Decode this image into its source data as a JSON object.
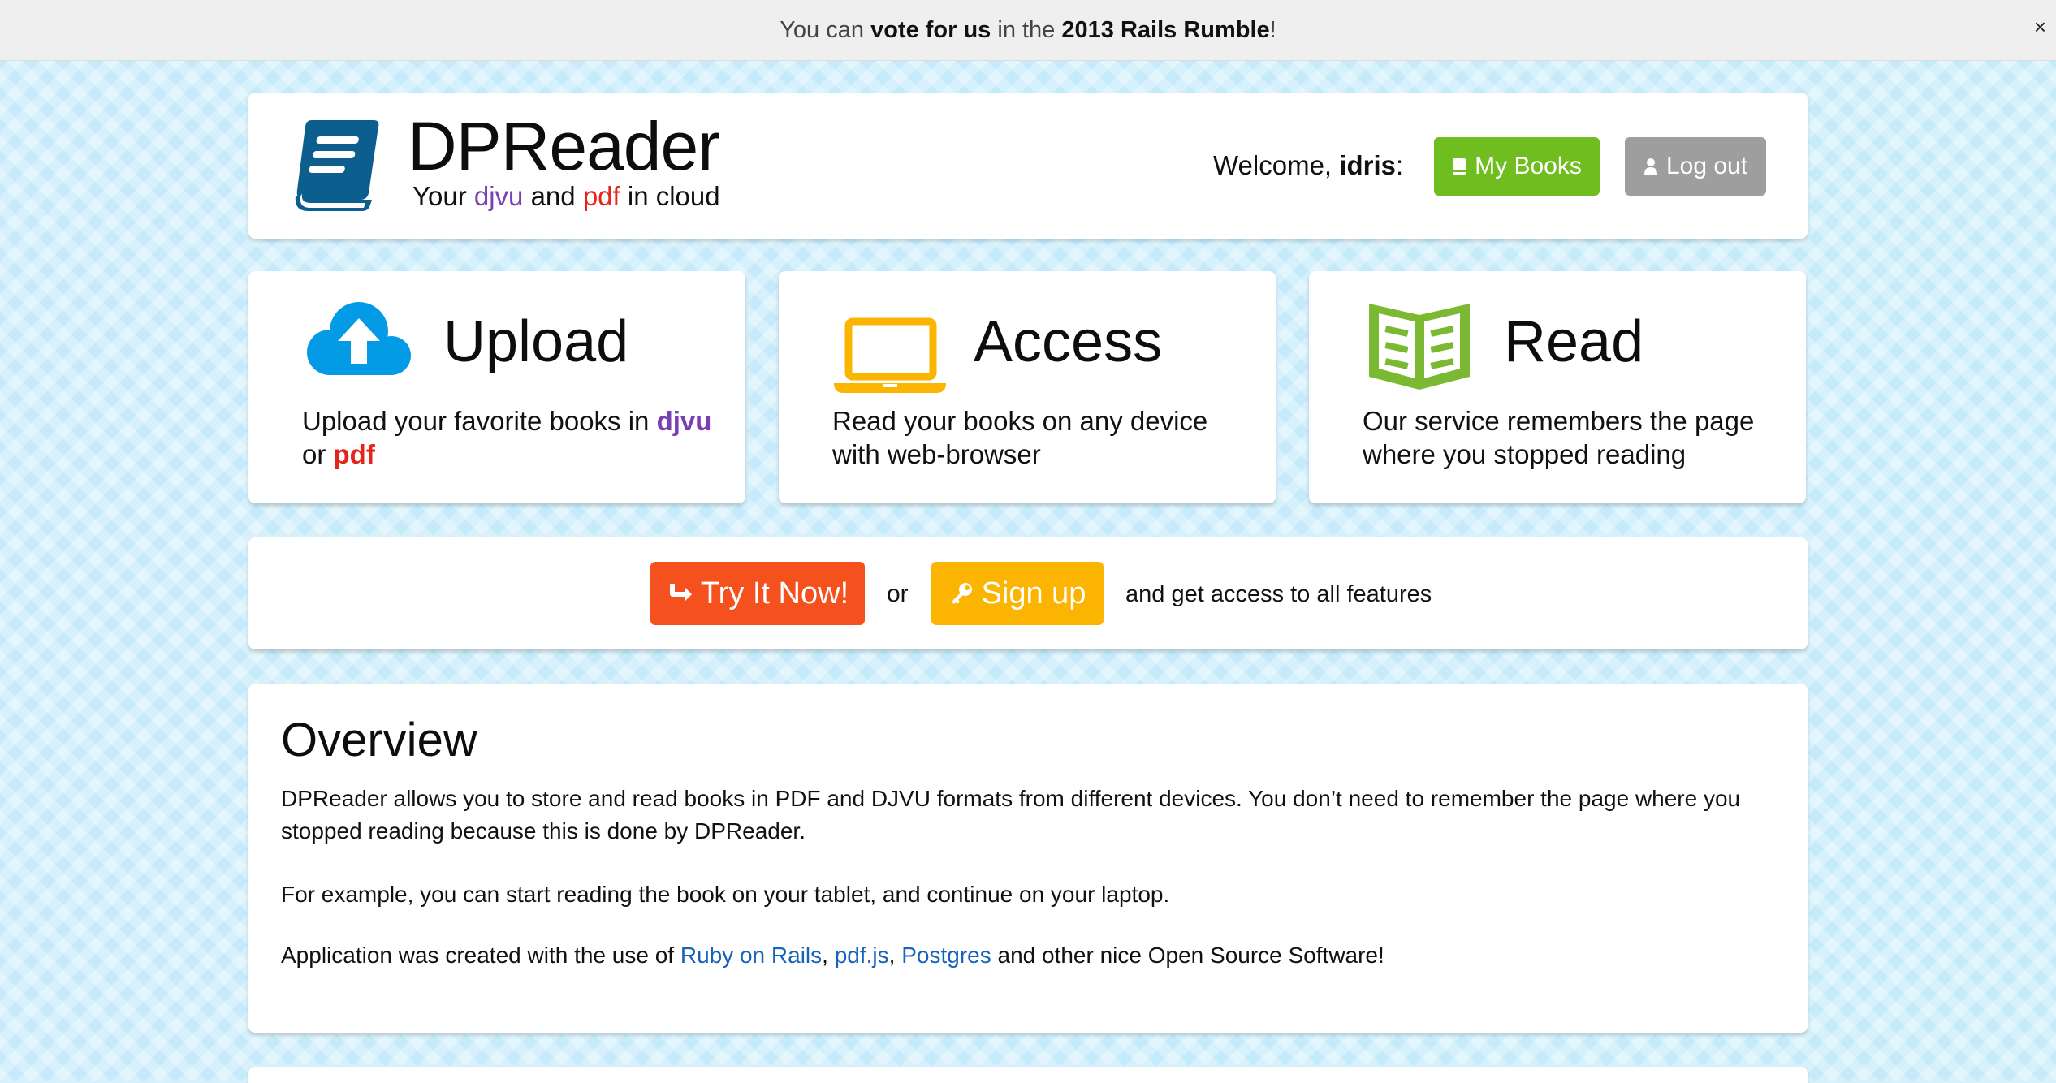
{
  "banner": {
    "text_before": "You can ",
    "vote_link": "vote for us",
    "text_middle": " in the ",
    "rumble": "2013 Rails Rumble",
    "text_after": "!",
    "close_label": "×"
  },
  "header": {
    "brand": "DPReader",
    "tagline_prefix": "Your ",
    "tagline_djvu": "djvu",
    "tagline_and": " and ",
    "tagline_pdf": "pdf",
    "tagline_suffix": " in cloud",
    "welcome_prefix": "Welcome, ",
    "username": "idris",
    "welcome_suffix": ":",
    "my_books_label": "My Books",
    "log_out_label": "Log out"
  },
  "features": [
    {
      "title": "Upload",
      "desc_prefix": "Upload your favorite books in ",
      "desc_djvu": "djvu",
      "desc_or": " or ",
      "desc_pdf": "pdf"
    },
    {
      "title": "Access",
      "desc": "Read your books on any device with web-browser"
    },
    {
      "title": "Read",
      "desc": "Our service remembers the page where you stopped reading"
    }
  ],
  "cta": {
    "try_label": "Try It Now!",
    "or": "or",
    "signup_label": "Sign up",
    "tail": "and get access to all features"
  },
  "overview": {
    "title": "Overview",
    "p1": "DPReader allows you to store and read books in PDF and DJVU formats from different devices. You don’t need to remember the page where you stopped reading because this is done by DPReader.",
    "p2": "For example, you can start reading the book on your tablet, and continue on your laptop.",
    "p3_prefix": "Application was created with the use of ",
    "link_rails": "Ruby on Rails",
    "sep1": ", ",
    "link_pdfjs": "pdf.js",
    "sep2": ", ",
    "link_postgres": "Postgres",
    "p3_suffix": " and other nice Open Source Software!"
  },
  "colors": {
    "brand_blue": "#0b5e8e",
    "green": "#6fbd1f",
    "gray": "#9e9e9e",
    "orange_red": "#f4511e",
    "amber": "#fbb400",
    "cloud_blue": "#039be5",
    "laptop_yellow": "#fbb400",
    "book_green": "#7cb932",
    "djvu_purple": "#7a3fb0",
    "pdf_red": "#e3251b",
    "link_blue": "#1663b7"
  },
  "icons": {
    "logo": "book-logo-icon",
    "upload": "cloud-upload-icon",
    "access": "laptop-icon",
    "read": "open-book-icon",
    "my_books": "book-icon",
    "log_out": "user-icon",
    "try": "arrow-share-icon",
    "signup": "key-icon"
  }
}
